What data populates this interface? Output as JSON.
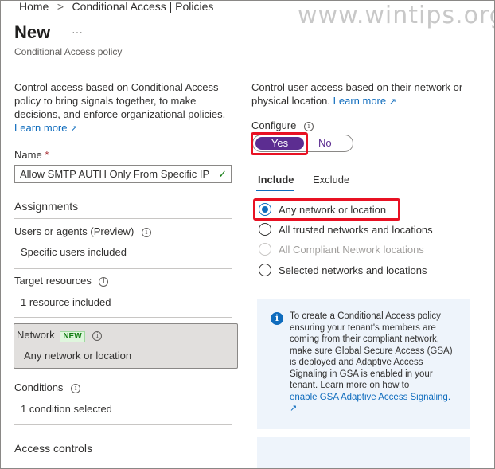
{
  "breadcrumb": {
    "home": "Home",
    "separator": ">",
    "current": "Conditional Access | Policies"
  },
  "watermark": "www.wintips.org",
  "page": {
    "title": "New",
    "more": "···",
    "subtitle": "Conditional Access policy"
  },
  "left": {
    "intro": "Control access based on Conditional Access policy to bring signals together, to make decisions, and enforce organizational policies.",
    "learn_more": "Learn more",
    "name_label": "Name",
    "required_mark": "*",
    "name_value": "Allow SMTP AUTH Only From Specific IP",
    "assignments": "Assignments",
    "users_label": "Users or agents (Preview)",
    "users_value": "Specific users included",
    "target_label": "Target resources",
    "target_value": "1 resource included",
    "network_label": "Network",
    "network_badge": "NEW",
    "network_value": "Any network or location",
    "conditions_label": "Conditions",
    "conditions_value": "1 condition selected",
    "access_controls": "Access controls"
  },
  "right": {
    "intro": "Control user access based on their network or physical location.",
    "learn_more": "Learn more",
    "configure_label": "Configure",
    "toggle_yes": "Yes",
    "toggle_no": "No",
    "tabs": [
      "Include",
      "Exclude"
    ],
    "options": [
      {
        "label": "Any network or location",
        "selected": true,
        "disabled": false
      },
      {
        "label": "All trusted networks and locations",
        "selected": false,
        "disabled": false
      },
      {
        "label": "All Compliant Network locations",
        "selected": false,
        "disabled": true
      },
      {
        "label": "Selected networks and locations",
        "selected": false,
        "disabled": false
      }
    ],
    "info_text": "To create a Conditional Access policy ensuring your tenant's members are coming from their compliant network, make sure Global Secure Access (GSA) is deployed and Adaptive Access Signaling in GSA is enabled in your tenant. Learn more on how to",
    "info_link": "enable GSA Adaptive Access Signaling."
  },
  "colors": {
    "accent": "#0f6cbd",
    "toggle_on": "#5c2d91",
    "highlight": "#e81123",
    "new_badge": "#107c10"
  }
}
